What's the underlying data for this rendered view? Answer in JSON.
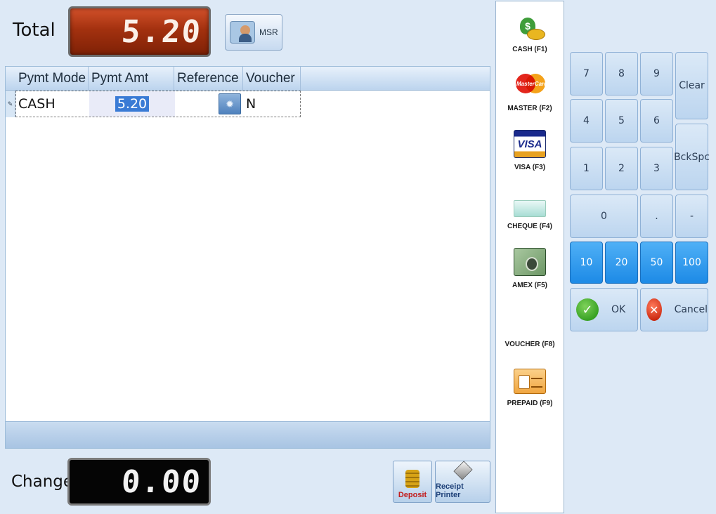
{
  "header": {
    "total_label": "Total",
    "total_value": "5.20",
    "msr_label": "MSR"
  },
  "grid": {
    "columns": [
      "Pymt Mode",
      "Pymt Amt",
      "Reference",
      "Voucher"
    ],
    "rows": [
      {
        "mode": "CASH",
        "amount": "5.20",
        "reference": "",
        "voucher": "N"
      }
    ]
  },
  "footer": {
    "change_label": "Change",
    "change_value": "0.00",
    "deposit_label": "Deposit",
    "printer_label": "Receipt Printer"
  },
  "payment_methods": [
    {
      "label": "CASH (F1)",
      "icon": "cash-icon"
    },
    {
      "label": "MASTER (F2)",
      "icon": "mastercard-icon",
      "icon_text": "MasterCard"
    },
    {
      "label": "VISA (F3)",
      "icon": "visa-icon",
      "icon_text": "VISA"
    },
    {
      "label": "CHEQUE (F4)",
      "icon": "cheque-icon"
    },
    {
      "label": "AMEX (F5)",
      "icon": "amex-icon"
    },
    {
      "label": "VOUCHER (F8)",
      "icon": ""
    },
    {
      "label": "PREPAID (F9)",
      "icon": "prepaid-card-icon"
    }
  ],
  "keypad": {
    "k7": "7",
    "k8": "8",
    "k9": "9",
    "clear": "Clear",
    "k4": "4",
    "k5": "5",
    "k6": "6",
    "bckspc": "BckSpc",
    "k1": "1",
    "k2": "2",
    "k3": "3",
    "k0": "0",
    "dot": ".",
    "minus": "-",
    "q10": "10",
    "q20": "20",
    "q50": "50",
    "q100": "100",
    "ok": "OK",
    "cancel": "Cancel"
  },
  "colors": {
    "total_display": "#a3310f",
    "quick_amount": "#1d8ae6",
    "background": "#dde9f6"
  }
}
